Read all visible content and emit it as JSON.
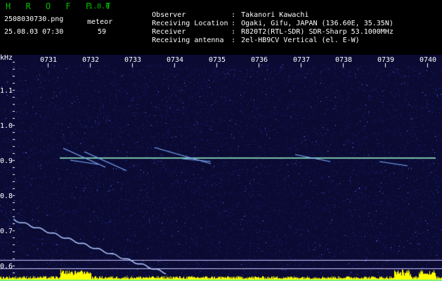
{
  "header": {
    "app_title": "H R O F F T",
    "app_version": "1.0.0",
    "filename": "2508030730.png",
    "datetime": "25.08.03 07:30",
    "meteor_label": "meteor",
    "meteor_count": "59",
    "info": [
      {
        "key": "Observer",
        "sep": ":",
        "value": "Takanori Kawachi"
      },
      {
        "key": "Receiving Location",
        "sep": ":",
        "value": "Ogaki, Gifu, JAPAN (136.60E, 35.35N)"
      },
      {
        "key": "Receiver",
        "sep": ":",
        "value": "R820T2(RTL-SDR) SDR-Sharp 53.1000MHz"
      },
      {
        "key": "Receiving antenna",
        "sep": ":",
        "value": "2el-HB9CV Vertical (el. E-W)"
      }
    ]
  },
  "plot": {
    "unit_label": "kHz",
    "time_ticks": [
      "0731",
      "0732",
      "0733",
      "0734",
      "0735",
      "0736",
      "0737",
      "0738",
      "0739",
      "0740"
    ],
    "freq_ticks": [
      "1.1",
      "1.0",
      "0.9",
      "0.8",
      "0.7",
      "0.6"
    ],
    "colors": {
      "background": "#0a0a33",
      "carrier": "#a0ffd0",
      "noise_bar": "#ffff00",
      "guide_line": "#c8c8ff"
    }
  }
}
